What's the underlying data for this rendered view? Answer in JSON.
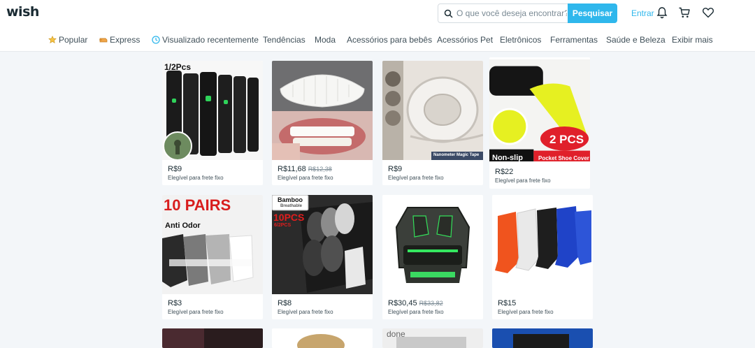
{
  "header": {
    "logo": "wish",
    "search_placeholder": "O que você deseja encontrar?",
    "search_button": "Pesquisar",
    "login": "Entrar",
    "icons": [
      "bell-icon",
      "cart-icon",
      "heart-icon"
    ]
  },
  "nav": {
    "items": [
      {
        "label": "Popular",
        "icon": "star-icon"
      },
      {
        "label": "Express",
        "icon": "express-icon"
      },
      {
        "label": "Visualizado recentemente",
        "icon": "clock-icon"
      },
      {
        "label": "Tendências"
      },
      {
        "label": "Moda"
      },
      {
        "label": "Acessórios para bebês"
      },
      {
        "label": "Acessórios Pet"
      },
      {
        "label": "Eletrônicos"
      },
      {
        "label": "Ferramentas"
      },
      {
        "label": "Saúde e Beleza"
      },
      {
        "label": "Exibir mais"
      }
    ]
  },
  "products": [
    {
      "price": "R$9",
      "old_price": "",
      "shipping": "Elegível para frete fixo",
      "image": "black-flashlights",
      "image_text": "1/2Pcs"
    },
    {
      "price": "R$11,68",
      "old_price": "R$12,38",
      "shipping": "Elegível para frete fixo",
      "image": "veneer-teeth",
      "image_text": ""
    },
    {
      "price": "R$9",
      "old_price": "",
      "shipping": "Elegível para frete fixo",
      "image": "nano-tape",
      "image_text": "Nanometer Magic Tape"
    },
    {
      "price": "R$22",
      "old_price": "",
      "shipping": "Elegível para frete fixo",
      "image": "yellow-shoe-covers",
      "image_text": "2 PCS",
      "image_text_2": "Non-slip",
      "image_text_3": "Pocket Shoe Cover"
    },
    {
      "price": "R$3",
      "old_price": "",
      "shipping": "Elegível para frete fixo",
      "image": "ankle-socks",
      "image_text": "10 PAIRS",
      "image_text_2": "Anti Odor"
    },
    {
      "price": "R$8",
      "old_price": "",
      "shipping": "Elegível para frete fixo",
      "image": "bamboo-socks",
      "image_text": "Bamboo",
      "image_text_2": "Breathable",
      "image_text_3": "10PCS",
      "image_text_4": "6/2PCS"
    },
    {
      "price": "R$30,45",
      "old_price": "R$33,82",
      "shipping": "Elegível para frete fixo",
      "image": "gaming-earbuds",
      "image_text": ""
    },
    {
      "price": "R$15",
      "old_price": "",
      "shipping": "Elegível para frete fixo",
      "image": "sport-socks",
      "image_text": ""
    }
  ],
  "partial_row": {
    "image_text": "done"
  },
  "colors": {
    "accent": "#2fb7ec",
    "background": "#f3f6f9",
    "text": "#192a32"
  }
}
